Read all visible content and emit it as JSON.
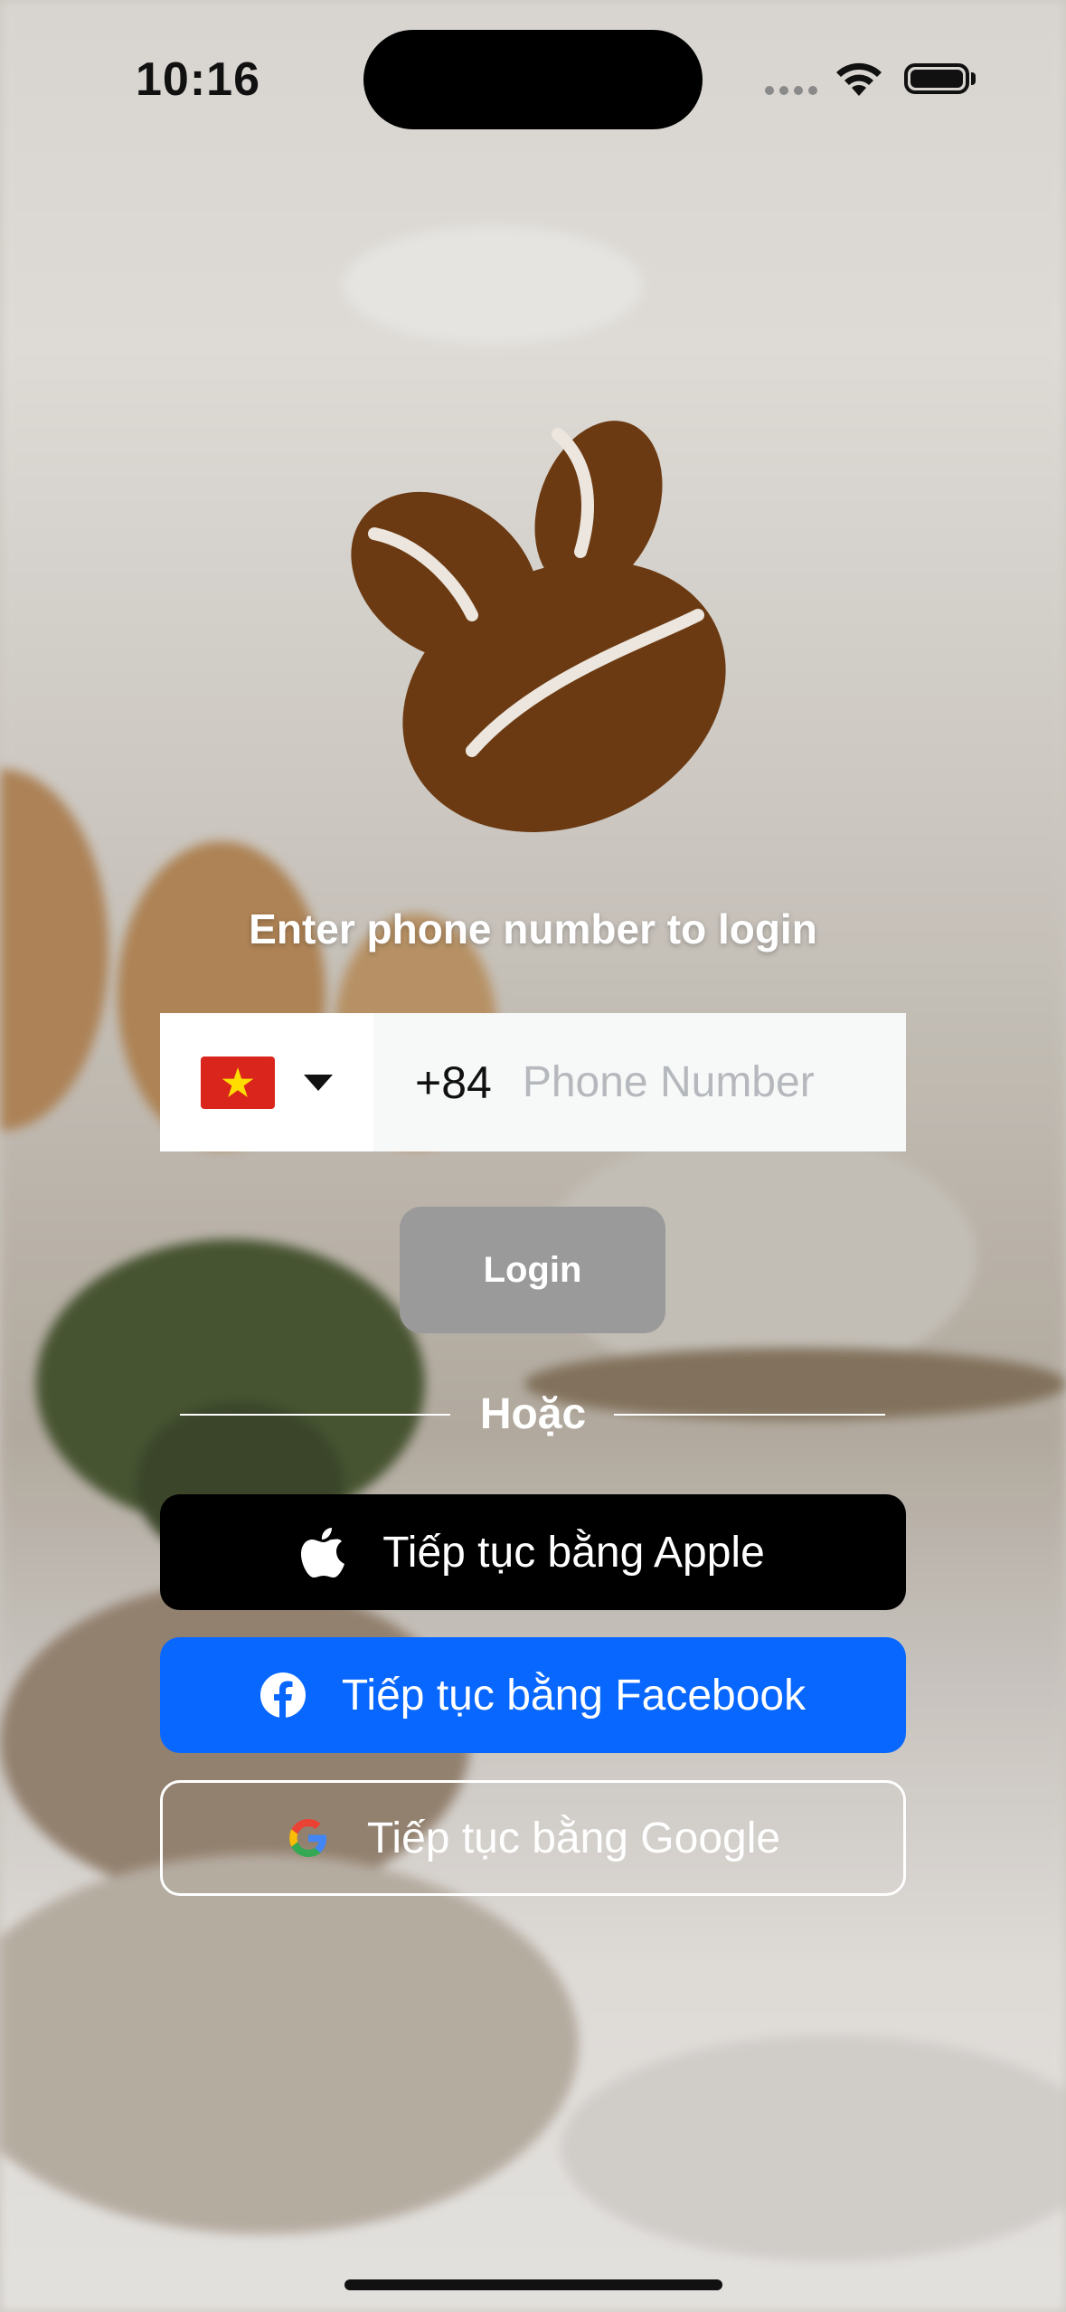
{
  "status_bar": {
    "time": "10:16"
  },
  "login": {
    "prompt": "Enter phone number to login",
    "country_flag": "vietnam-flag",
    "country_code": "+84",
    "phone_placeholder": "Phone Number",
    "phone_value": "",
    "login_label": "Login"
  },
  "divider_label": "Hoặc",
  "social": {
    "apple_label": "Tiếp tục bằng Apple",
    "facebook_label": "Tiếp tục bằng Facebook",
    "google_label": "Tiếp tục bằng Google"
  },
  "colors": {
    "logo": "#6b3a12",
    "facebook": "#0867ff",
    "login_disabled": "#9a9a9a"
  }
}
